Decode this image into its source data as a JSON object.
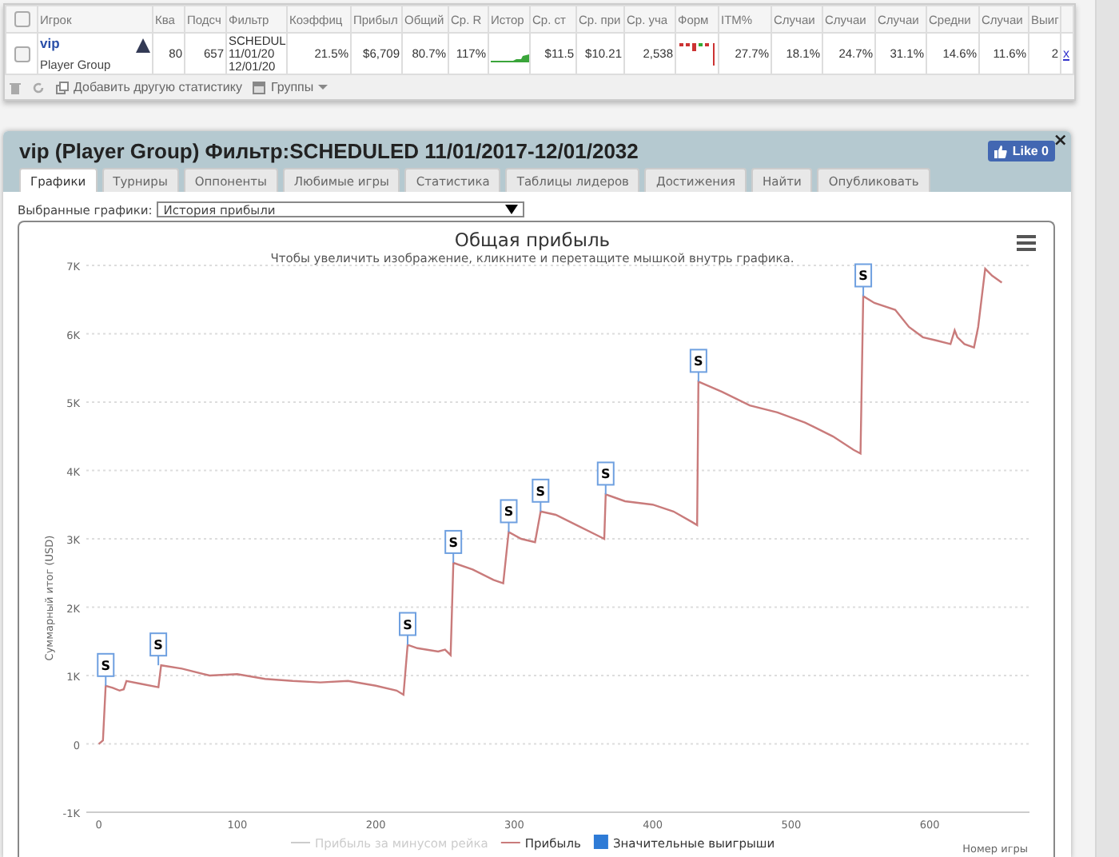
{
  "stats_table": {
    "header_checkbox": {
      "checked": false
    },
    "columns": [
      "Игрок",
      "Ква",
      "Подсч",
      "Фильтр",
      "Коэффиц",
      "Прибыл",
      "Общий",
      "Ср. R",
      "Истор",
      "Ср. ст",
      "Ср. при",
      "Ср. уча",
      "Форм",
      "ITM%",
      "Случаи",
      "Случаи",
      "Случаи",
      "Средни",
      "Случаи",
      "Выиг",
      ""
    ],
    "rows": [
      {
        "checked": false,
        "cells": [
          {
            "kind": "player",
            "name": "vip",
            "group": "Player Group"
          },
          {
            "kind": "text",
            "text": "80"
          },
          {
            "kind": "text",
            "text": "657"
          },
          {
            "kind": "lines",
            "lines": [
              "SCHEDUL",
              "11/01/20",
              "12/01/20"
            ]
          },
          {
            "kind": "text",
            "text": "21.5%"
          },
          {
            "kind": "text",
            "text": "$6,709"
          },
          {
            "kind": "text",
            "text": "80.7%"
          },
          {
            "kind": "text",
            "text": "117%"
          },
          {
            "kind": "sparkline"
          },
          {
            "kind": "text",
            "text": "$11.5"
          },
          {
            "kind": "text",
            "text": "$10.21"
          },
          {
            "kind": "text",
            "text": "2,538"
          },
          {
            "kind": "form"
          },
          {
            "kind": "text",
            "text": "27.7%"
          },
          {
            "kind": "text",
            "text": "18.1%"
          },
          {
            "kind": "text",
            "text": "24.7%"
          },
          {
            "kind": "text",
            "text": "31.1%"
          },
          {
            "kind": "text",
            "text": "14.6%"
          },
          {
            "kind": "text",
            "text": "11.6%"
          },
          {
            "kind": "text",
            "text": "2"
          },
          {
            "kind": "remove",
            "text": "x"
          }
        ]
      }
    ],
    "toolbar": {
      "add_stat": "Добавить другую статистику",
      "groups": "Группы"
    }
  },
  "panel": {
    "title": "vip (Player Group) Фильтр:SCHEDULED 11/01/2017-12/01/2032",
    "like": "Like 0",
    "close": "×",
    "tabs": [
      {
        "label": "Графики",
        "selected": true
      },
      {
        "label": "Турниры",
        "selected": false
      },
      {
        "label": "Оппоненты",
        "selected": false
      },
      {
        "label": "Любимые игры",
        "selected": false
      },
      {
        "label": "Статистика",
        "selected": false
      },
      {
        "label": "Таблицы лидеров",
        "selected": false
      },
      {
        "label": "Достижения",
        "selected": false
      },
      {
        "label": "Найти",
        "selected": false
      },
      {
        "label": "Опубликовать",
        "selected": false
      }
    ],
    "chart_select": {
      "label": "Выбранные графики:",
      "value": "История прибыли"
    },
    "chart": {
      "subtitle": "Чтобы увеличить изображение, кликните и перетащите мышкой внутрь графика.",
      "legend": [
        {
          "kind": "line",
          "label": "Прибыль за минусом рейка",
          "visible": false
        },
        {
          "kind": "series",
          "visible": true
        },
        {
          "kind": "flag",
          "label": "Значительные выигрыши",
          "visible": true
        }
      ],
      "chart_data": {
        "type": "line",
        "title": "Общая прибыль",
        "xlabel": "Номер игры",
        "ylabel": "Суммарный итог (USD)",
        "grid": true,
        "x": [
          0,
          3,
          5,
          10,
          15,
          18,
          20,
          30,
          43,
          45,
          60,
          80,
          100,
          120,
          140,
          160,
          180,
          200,
          215,
          220,
          223,
          230,
          245,
          250,
          254,
          256,
          270,
          285,
          292,
          296,
          305,
          315,
          319,
          330,
          345,
          360,
          365,
          366,
          380,
          400,
          415,
          428,
          432,
          433,
          450,
          470,
          490,
          510,
          530,
          545,
          550,
          552,
          560,
          575,
          585,
          595,
          605,
          615,
          618,
          620,
          625,
          632,
          635,
          640,
          645,
          652
        ],
        "series": [
          {
            "name": "Прибыль",
            "color": "#c97b7b",
            "values": [
              0,
              50,
              850,
              820,
              780,
              800,
              920,
              880,
              830,
              1150,
              1100,
              1000,
              1020,
              950,
              920,
              900,
              920,
              850,
              780,
              720,
              1450,
              1400,
              1350,
              1380,
              1300,
              2650,
              2550,
              2400,
              2350,
              3100,
              3000,
              2950,
              3400,
              3350,
              3200,
              3050,
              3000,
              3650,
              3550,
              3500,
              3400,
              3250,
              3200,
              5300,
              5150,
              4950,
              4850,
              4700,
              4500,
              4300,
              4250,
              6550,
              6450,
              6350,
              6100,
              5950,
              5900,
              5850,
              6050,
              5950,
              5850,
              5800,
              6100,
              6950,
              6850,
              6750
            ]
          }
        ],
        "xlim": [
          -9,
          672
        ],
        "ylim": [
          -1000,
          7000
        ],
        "xticks": [
          0,
          100,
          200,
          300,
          400,
          500,
          600
        ],
        "yticks": [
          {
            "value": -1000,
            "label": "-1K"
          },
          {
            "value": 0,
            "label": "0"
          },
          {
            "value": 1000,
            "label": "1K"
          },
          {
            "value": 2000,
            "label": "2K"
          },
          {
            "value": 3000,
            "label": "3K"
          },
          {
            "value": 4000,
            "label": "4K"
          },
          {
            "value": 5000,
            "label": "5K"
          },
          {
            "value": 6000,
            "label": "6K"
          },
          {
            "value": 7000,
            "label": "7K"
          }
        ],
        "annotations": [
          {
            "x": 5,
            "y": 850,
            "text": "S"
          },
          {
            "x": 43,
            "y": 1150,
            "text": "S"
          },
          {
            "x": 223,
            "y": 1450,
            "text": "S"
          },
          {
            "x": 256,
            "y": 2650,
            "text": "S"
          },
          {
            "x": 296,
            "y": 3100,
            "text": "S"
          },
          {
            "x": 319,
            "y": 3400,
            "text": "S"
          },
          {
            "x": 366,
            "y": 3650,
            "text": "S"
          },
          {
            "x": 433,
            "y": 5300,
            "text": "S"
          },
          {
            "x": 552,
            "y": 6550,
            "text": "S"
          }
        ]
      }
    }
  }
}
